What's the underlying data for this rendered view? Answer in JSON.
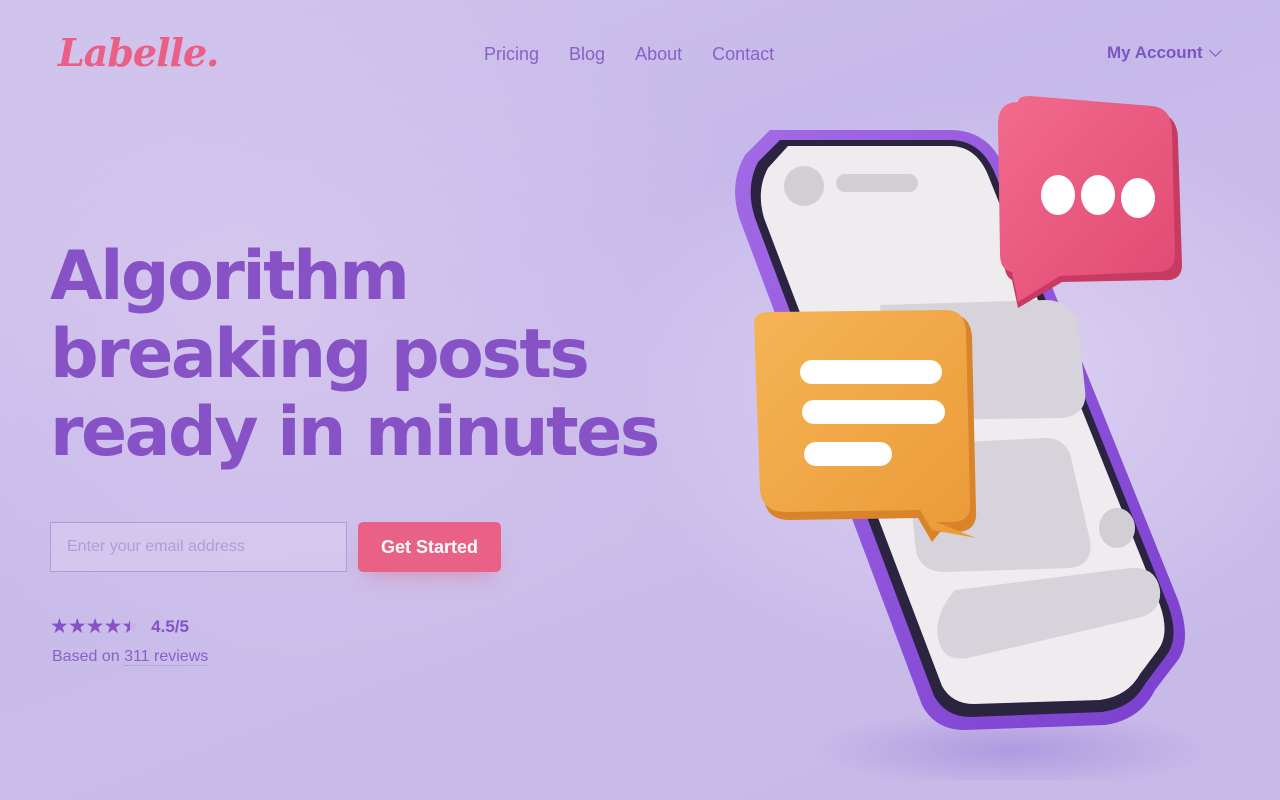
{
  "brand": {
    "logo_text": "Labelle",
    "logo_dot": "."
  },
  "nav": [
    {
      "label": "Pricing"
    },
    {
      "label": "Blog"
    },
    {
      "label": "About"
    },
    {
      "label": "Contact"
    }
  ],
  "account": {
    "label": "My Account"
  },
  "hero": {
    "headline_lines": [
      "Algorithm",
      "breaking posts",
      "ready in minutes"
    ],
    "email_placeholder": "Enter your email address",
    "cta_label": "Get Started"
  },
  "rating": {
    "score_text": "4.5/5",
    "stars_value": 4.5,
    "stars_max": 5,
    "reviews_prefix": "Based on",
    "reviews_count": "311 reviews"
  },
  "colors": {
    "accent_purple": "#8652c6",
    "brand_pink": "#ea6187",
    "bubble_orange": "#f2a94a",
    "phone_frame": "#8c4fd6"
  },
  "icons": [
    "chevron-down-icon",
    "star-icon",
    "chat-bubble-dots-icon",
    "chat-bubble-text-icon",
    "smartphone-icon"
  ]
}
